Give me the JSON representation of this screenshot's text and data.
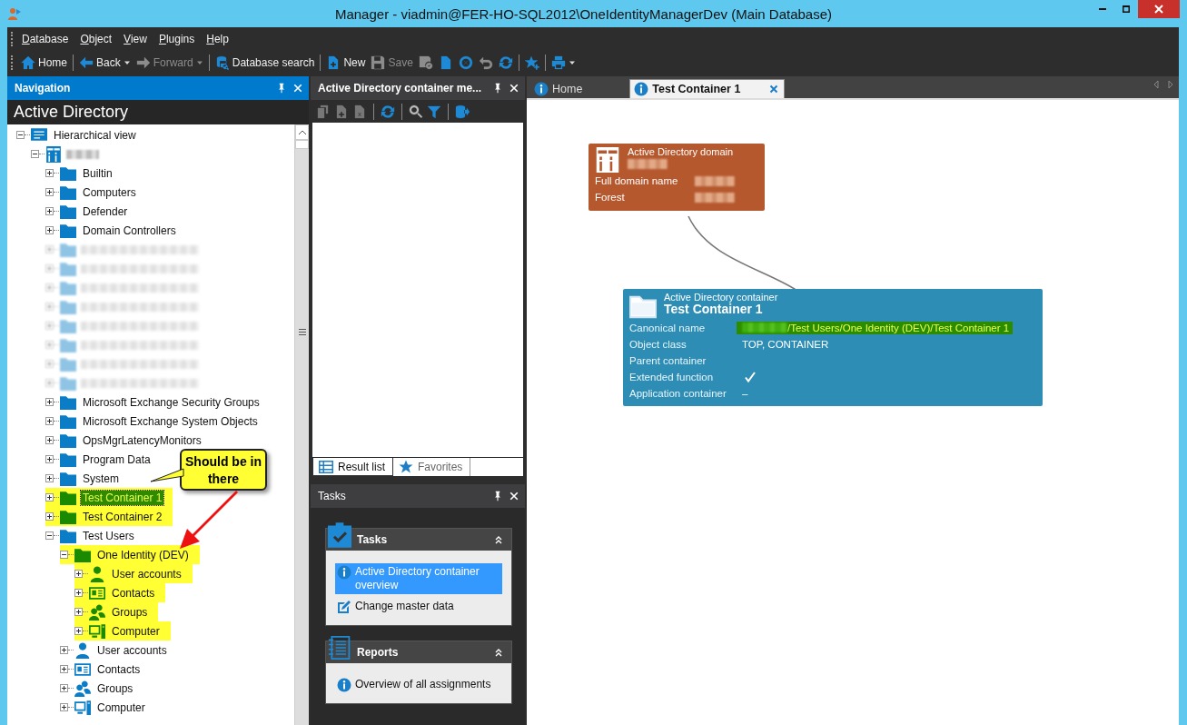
{
  "window": {
    "title": "Manager - viadmin@FER-HO-SQL2012\\OneIdentityManagerDev (Main Database)"
  },
  "menu": [
    "Database",
    "Object",
    "View",
    "Plugins",
    "Help"
  ],
  "toolbar": [
    {
      "kind": "home",
      "label": "Home",
      "disabled": false
    },
    {
      "kind": "separator"
    },
    {
      "kind": "back",
      "label": "Back",
      "dropdown": true,
      "disabled": false
    },
    {
      "kind": "forward",
      "label": "Forward",
      "dropdown": true,
      "disabled": true
    },
    {
      "kind": "separator"
    },
    {
      "kind": "dbsearch",
      "label": "Database search",
      "disabled": false
    },
    {
      "kind": "separator"
    },
    {
      "kind": "new",
      "label": "New",
      "disabled": false
    },
    {
      "kind": "save",
      "label": "Save",
      "disabled": true
    },
    {
      "kind": "savecheck",
      "disabled": true
    },
    {
      "kind": "docx",
      "disabled": false
    },
    {
      "kind": "circlex",
      "disabled": false
    },
    {
      "kind": "undo",
      "disabled": true
    },
    {
      "kind": "refresh",
      "disabled": false
    },
    {
      "kind": "separator"
    },
    {
      "kind": "favadd",
      "disabled": false
    },
    {
      "kind": "separator"
    },
    {
      "kind": "print",
      "dropdown": true,
      "disabled": false
    }
  ],
  "navigation": {
    "title": "Navigation",
    "heading": "Active Directory",
    "tree": [
      {
        "kind": "ads",
        "label": "Hierarchical view",
        "expanded": true,
        "highlighted": false,
        "selected": false,
        "children": [
          {
            "kind": "domain",
            "redacted": true,
            "expanded": true,
            "highlighted": false,
            "selected": false,
            "children": [
              {
                "kind": "folder",
                "label": "Builtin",
                "expanded": false,
                "highlighted": false,
                "selected": false
              },
              {
                "kind": "folder",
                "label": "Computers",
                "expanded": false,
                "highlighted": false,
                "selected": false
              },
              {
                "kind": "folder",
                "label": "Defender",
                "expanded": false,
                "highlighted": false,
                "selected": false
              },
              {
                "kind": "folder",
                "label": "Domain Controllers",
                "expanded": false,
                "highlighted": false,
                "selected": false
              },
              {
                "kind": "folder",
                "redacted": true,
                "expanded": false,
                "highlighted": false,
                "selected": false
              },
              {
                "kind": "folder",
                "redacted": true,
                "expanded": false,
                "highlighted": false,
                "selected": false
              },
              {
                "kind": "folder",
                "redacted": true,
                "expanded": false,
                "highlighted": false,
                "selected": false
              },
              {
                "kind": "folder",
                "redacted": true,
                "expanded": false,
                "highlighted": false,
                "selected": false
              },
              {
                "kind": "folder",
                "redacted": true,
                "expanded": false,
                "highlighted": false,
                "selected": false
              },
              {
                "kind": "folder",
                "redacted": true,
                "expanded": false,
                "highlighted": false,
                "selected": false
              },
              {
                "kind": "folder",
                "redacted": true,
                "expanded": false,
                "highlighted": false,
                "selected": false
              },
              {
                "kind": "folder",
                "redacted": true,
                "expanded": false,
                "highlighted": false,
                "selected": false
              },
              {
                "kind": "folder",
                "label": "Microsoft Exchange Security Groups",
                "expanded": false,
                "highlighted": false,
                "selected": false
              },
              {
                "kind": "folder",
                "label": "Microsoft Exchange System Objects",
                "expanded": false,
                "highlighted": false,
                "selected": false
              },
              {
                "kind": "folder",
                "label": "OpsMgrLatencyMonitors",
                "expanded": false,
                "highlighted": false,
                "selected": false
              },
              {
                "kind": "folder",
                "label": "Program Data",
                "expanded": false,
                "highlighted": false,
                "selected": false
              },
              {
                "kind": "folder",
                "label": "System",
                "expanded": false,
                "highlighted": false,
                "selected": false
              },
              {
                "kind": "folder",
                "label": "Test Container 1",
                "expanded": false,
                "highlighted": true,
                "selected": true
              },
              {
                "kind": "folder",
                "label": "Test Container 2",
                "expanded": false,
                "highlighted": true,
                "selected": false
              },
              {
                "kind": "folder",
                "label": "Test Users",
                "expanded": true,
                "highlighted": false,
                "selected": false,
                "children": [
                  {
                    "kind": "folder",
                    "label": "One Identity (DEV)",
                    "expanded": true,
                    "highlighted": true,
                    "selected": false,
                    "children": [
                      {
                        "kind": "user",
                        "label": "User accounts",
                        "expanded": false,
                        "highlighted": true,
                        "selected": false
                      },
                      {
                        "kind": "contact",
                        "label": "Contacts",
                        "expanded": false,
                        "highlighted": true,
                        "selected": false
                      },
                      {
                        "kind": "group",
                        "label": "Groups",
                        "expanded": false,
                        "highlighted": true,
                        "selected": false
                      },
                      {
                        "kind": "computer",
                        "label": "Computer",
                        "expanded": false,
                        "highlighted": true,
                        "selected": false
                      }
                    ]
                  },
                  {
                    "kind": "user",
                    "label": "User accounts",
                    "expanded": false,
                    "highlighted": false,
                    "selected": false
                  },
                  {
                    "kind": "contact",
                    "label": "Contacts",
                    "expanded": false,
                    "highlighted": false,
                    "selected": false
                  },
                  {
                    "kind": "group",
                    "label": "Groups",
                    "expanded": false,
                    "highlighted": false,
                    "selected": false
                  },
                  {
                    "kind": "computer",
                    "label": "Computer",
                    "expanded": false,
                    "highlighted": false,
                    "selected": false
                  }
                ]
              }
            ]
          }
        ]
      }
    ],
    "callout": "Should be in there"
  },
  "list_panel": {
    "title": "Active Directory container me...",
    "toolbar": [
      {
        "kind": "copy",
        "disabled": true
      },
      {
        "kind": "adddoc",
        "disabled": true
      },
      {
        "kind": "deldoc",
        "disabled": true
      },
      {
        "kind": "separator"
      },
      {
        "kind": "refresh",
        "disabled": false
      },
      {
        "kind": "separator"
      },
      {
        "kind": "search",
        "disabled": false
      },
      {
        "kind": "filter",
        "disabled": false
      },
      {
        "kind": "separator"
      },
      {
        "kind": "dbexport",
        "disabled": false
      }
    ],
    "tabs": [
      {
        "label": "Result list",
        "kind": "list",
        "selected": true
      },
      {
        "label": "Favorites",
        "kind": "star",
        "selected": false
      }
    ]
  },
  "tasks_panel": {
    "title": "Tasks",
    "sections": [
      {
        "kind": "tasks",
        "title": "Tasks",
        "items": [
          {
            "kind": "info",
            "label": "Active Directory container overview",
            "selected": true
          },
          {
            "kind": "edit",
            "label": "Change master data",
            "selected": false
          }
        ]
      },
      {
        "kind": "reports",
        "title": "Reports",
        "items": [
          {
            "kind": "info",
            "label": "Overview of all assignments",
            "selected": false
          }
        ]
      }
    ]
  },
  "document_tabs": [
    {
      "label": "Home",
      "selected": false
    },
    {
      "label": "Test Container 1",
      "selected": true
    }
  ],
  "diagram": {
    "nodes": [
      {
        "kind": "domain",
        "type_label": "Active Directory domain",
        "name_redacted": true,
        "fields": [
          {
            "label": "Full domain name",
            "redacted": true
          },
          {
            "label": "Forest",
            "redacted": true
          }
        ]
      },
      {
        "kind": "container",
        "type_label": "Active Directory container",
        "name": "Test Container 1",
        "fields": [
          {
            "label": "Canonical name",
            "value": "/Test Users/One Identity (DEV)/Test Container 1",
            "redacted": true,
            "highlighted": true
          },
          {
            "label": "Object class",
            "value": "TOP, CONTAINER"
          },
          {
            "label": "Parent container"
          },
          {
            "label": "Extended function",
            "checked": true
          },
          {
            "label": "Application container",
            "value": "–"
          }
        ]
      }
    ]
  }
}
